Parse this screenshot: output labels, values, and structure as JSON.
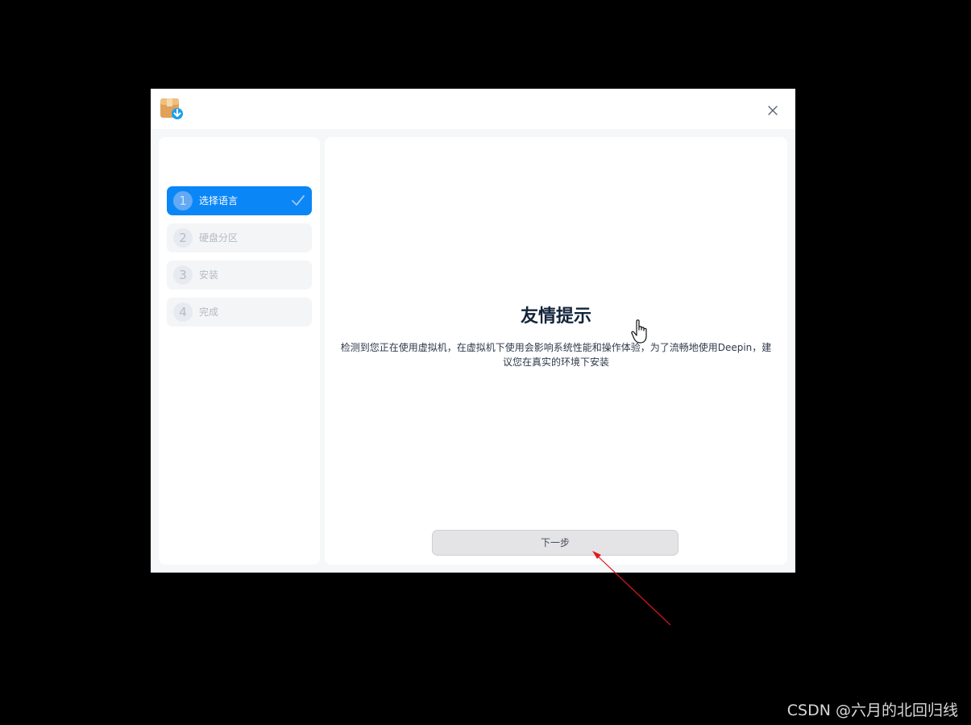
{
  "window": {
    "app_icon": "installer-package-icon",
    "close_icon": "close-icon"
  },
  "sidebar": {
    "steps": [
      {
        "number": "1",
        "label": "选择语言",
        "state": "completed"
      },
      {
        "number": "2",
        "label": "硬盘分区",
        "state": "pending"
      },
      {
        "number": "3",
        "label": "安装",
        "state": "pending"
      },
      {
        "number": "4",
        "label": "完成",
        "state": "pending"
      }
    ]
  },
  "content": {
    "title": "友情提示",
    "message": "检测到您正在使用虚拟机，在虚拟机下使用会影响系统性能和操作体验，为了流畅地使用Deepin，建议您在真实的环境下安装",
    "next_button": "下一步"
  },
  "colors": {
    "accent": "#0b86f6",
    "annotation_arrow": "#e3191c"
  },
  "watermark": "CSDN @六月的北回归线"
}
